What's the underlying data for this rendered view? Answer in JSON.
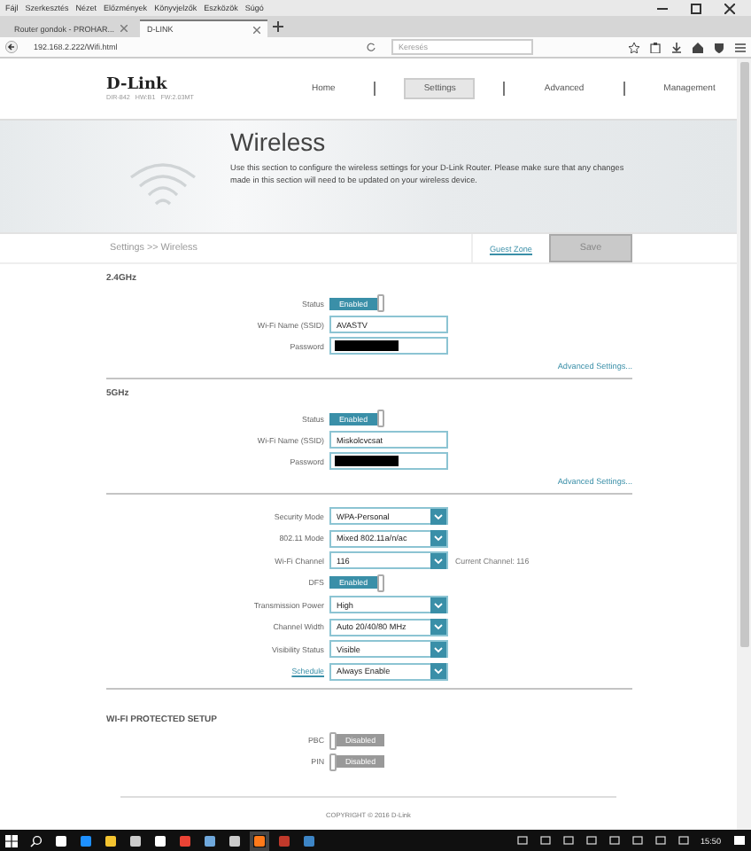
{
  "browser": {
    "menu": [
      "Fájl",
      "Szerkesztés",
      "Nézet",
      "Előzmények",
      "Könyvjelzők",
      "Eszközök",
      "Súgó"
    ],
    "tabs": [
      {
        "label": "Router gondok - PROHAR...",
        "selected": false
      },
      {
        "label": "D-LINK",
        "selected": true
      }
    ],
    "address": "192.168.2.222/Wifi.html",
    "search": {
      "placeholder": "Keresés"
    }
  },
  "header": {
    "logo": "D-Link",
    "model": "DIR-842   HW:B1   FW:2.03MT",
    "nav": [
      {
        "label": "Home",
        "selected": false
      },
      {
        "label": "Settings",
        "selected": true
      },
      {
        "label": "Advanced",
        "selected": false
      },
      {
        "label": "Management",
        "selected": false
      }
    ]
  },
  "hero": {
    "title": "Wireless",
    "description": "Use this section to configure the wireless settings for your D-Link Router. Please make sure that any changes made in this section will need to be updated on your wireless device."
  },
  "breadcrumb": "Settings >> Wireless",
  "guest_zone": "Guest Zone",
  "save": {
    "label": "Save",
    "disabled": true
  },
  "sections": [
    {
      "title": "2.4GHz",
      "rows": [
        {
          "kind": "toggle",
          "label": "Status",
          "value": "Enabled",
          "on": true
        },
        {
          "kind": "text",
          "label": "Wi-Fi Name (SSID)",
          "value": "AVASTV"
        },
        {
          "kind": "password",
          "label": "Password",
          "redacted": true
        }
      ],
      "link": "Advanced Settings..."
    },
    {
      "title": "5GHz",
      "rows": [
        {
          "kind": "toggle",
          "label": "Status",
          "value": "Enabled",
          "on": true
        },
        {
          "kind": "text",
          "label": "Wi-Fi Name (SSID)",
          "value": "Miskolcvcsat"
        },
        {
          "kind": "password",
          "label": "Password",
          "redacted": true
        }
      ],
      "link": "Advanced Settings..."
    },
    {
      "rows": [
        {
          "kind": "select",
          "label": "Security Mode",
          "value": "WPA-Personal"
        },
        {
          "kind": "select",
          "label": "802.11 Mode",
          "value": "Mixed 802.11a/n/ac"
        },
        {
          "kind": "select",
          "label": "Wi-Fi Channel",
          "value": "116",
          "note": "Current Channel: 116"
        },
        {
          "kind": "toggle",
          "label": "DFS",
          "value": "Enabled",
          "on": true
        },
        {
          "kind": "select",
          "label": "Transmission Power",
          "value": "High"
        },
        {
          "kind": "select",
          "label": "Channel Width",
          "value": "Auto 20/40/80 MHz"
        },
        {
          "kind": "select",
          "label": "Visibility Status",
          "value": "Visible"
        },
        {
          "kind": "select",
          "label": "Schedule",
          "label_link": true,
          "value": "Always Enable"
        }
      ]
    },
    {
      "title": "WI-FI PROTECTED SETUP",
      "rows": [
        {
          "kind": "toggle",
          "label": "PBC",
          "value": "Disabled",
          "on": false
        },
        {
          "kind": "toggle",
          "label": "PIN",
          "value": "Disabled",
          "on": false
        }
      ]
    }
  ],
  "copyright": "COPYRIGHT © 2016 D-Link",
  "taskbar": {
    "clock": "15:50"
  }
}
